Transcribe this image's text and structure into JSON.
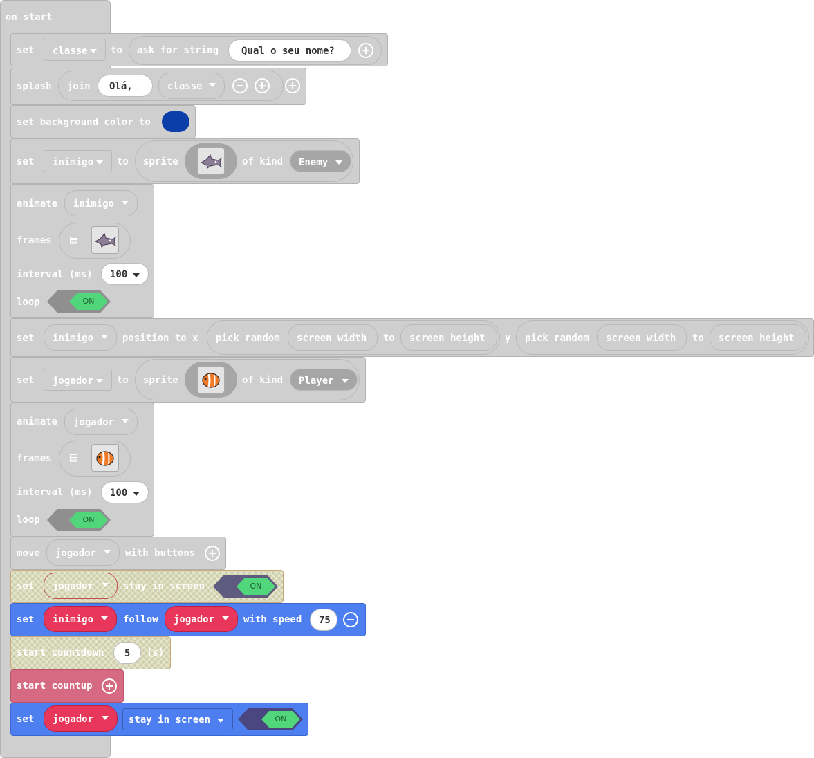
{
  "hat": {
    "label": "on start"
  },
  "b1": {
    "set": "set",
    "var": "classe",
    "to": "to",
    "ask": "ask for string",
    "prompt": "Qual o seu nome?"
  },
  "b2": {
    "splash": "splash",
    "join": "join",
    "str": "Olá, ",
    "var": "classe"
  },
  "b3": {
    "label": "set background color to",
    "color": "#0b3ea8"
  },
  "b4": {
    "set": "set",
    "var": "inimigo",
    "to": "to",
    "sprite": "sprite",
    "of_kind": "of kind",
    "kind": "Enemy",
    "icon": "shark-icon"
  },
  "b5": {
    "animate": "animate",
    "var": "inimigo",
    "frames": "frames",
    "interval": "interval (ms)",
    "ms": "100",
    "loop": "loop",
    "on": "ON",
    "icon": "shark-icon"
  },
  "b6": {
    "set": "set",
    "var": "inimigo",
    "pos": "position to x",
    "pick1": "pick random",
    "sw1": "screen width",
    "to1": "to",
    "sh1": "screen height",
    "y": "y",
    "pick2": "pick random",
    "sw2": "screen width",
    "to2": "to",
    "sh2": "screen height"
  },
  "b7": {
    "set": "set",
    "var": "jogador",
    "to": "to",
    "sprite": "sprite",
    "of_kind": "of kind",
    "kind": "Player",
    "icon": "clownfish-icon"
  },
  "b8": {
    "animate": "animate",
    "var": "jogador",
    "frames": "frames",
    "interval": "interval (ms)",
    "ms": "100",
    "loop": "loop",
    "on": "ON",
    "icon": "clownfish-icon"
  },
  "b9": {
    "move": "move",
    "var": "jogador",
    "with": "with buttons"
  },
  "b10": {
    "set": "set",
    "var": "jogador",
    "stay": "stay in screen",
    "on": "ON"
  },
  "b11": {
    "set": "set",
    "var1": "inimigo",
    "follow": "follow",
    "var2": "jogador",
    "speed": "with speed",
    "value": "75"
  },
  "b12": {
    "label": "start countdown",
    "value": "5",
    "unit": "(s)"
  },
  "b13": {
    "label": "start countup"
  },
  "b14": {
    "set": "set",
    "var": "jogador",
    "stay": "stay in screen",
    "on": "ON"
  }
}
